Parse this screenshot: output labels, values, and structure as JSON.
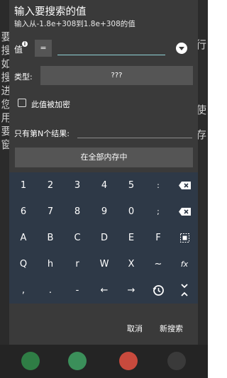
{
  "dialog": {
    "title": "输入要搜索的值",
    "subtitle": "输入从-1.8e+308到1.8e+308的值",
    "value_label": "值",
    "operator": "=",
    "type_label": "类型:",
    "type_value": "???",
    "encrypted_label": "此值被加密",
    "count_label": "只有第N个结果:",
    "memory_button": "在全部内存中",
    "cancel_button": "取消",
    "new_search_button": "新搜索"
  },
  "background": {
    "left_text": [
      "要",
      "搜",
      "如",
      "搜",
      "进",
      "您",
      "用",
      "要",
      "窗"
    ],
    "right_text": [
      "行",
      "使",
      "存"
    ]
  },
  "keyboard": {
    "row1": [
      "1",
      "2",
      "3",
      "4",
      "5",
      ":"
    ],
    "row2": [
      "6",
      "7",
      "8",
      "9",
      "0",
      ";"
    ],
    "row3": [
      "A",
      "B",
      "C",
      "D",
      "E",
      "F"
    ],
    "row4": [
      "Q",
      "h",
      "r",
      "W",
      "X",
      "~",
      "fx"
    ],
    "row5": [
      ",",
      ".",
      "-",
      "←",
      "→"
    ]
  },
  "colors": {
    "dialog_bg": "#3a3a3a",
    "keyboard_bg": "#2e3947",
    "field_bg": "#555555",
    "accent_underline": "#8fd3d7"
  },
  "icons": {
    "backspace": "backspace-icon",
    "select_all": "select-all-icon",
    "history": "history-icon",
    "collapse": "collapse-keyboard-icon",
    "dropdown": "dropdown-icon",
    "info": "info-icon"
  }
}
